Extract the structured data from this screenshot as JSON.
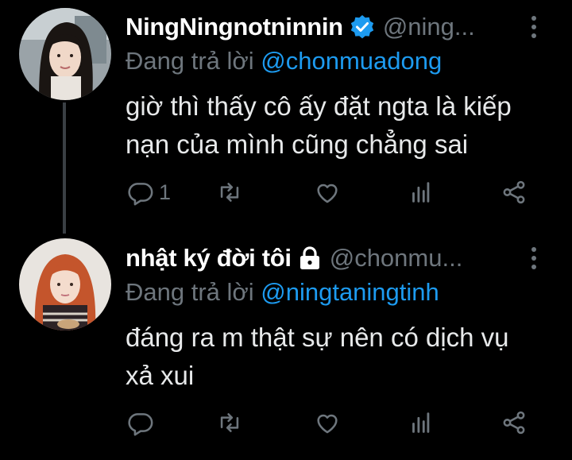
{
  "tweets": [
    {
      "display_name": "NingNingnotninnin",
      "handle": "@ning...",
      "verified": true,
      "replying_prefix": "Đang trả lời",
      "replying_to": "@chonmuadong",
      "text_lines": [
        "giờ thì thấy cô ấy đặt ngta là kiếp",
        "nạn của mình cũng chẳng sai"
      ],
      "reply_count": "1"
    },
    {
      "display_name": "nhật ký đời tôi",
      "handle": "@chonmu...",
      "locked": true,
      "replying_prefix": "Đang trả lời",
      "replying_to": "@ningtaningtinh",
      "text_lines": [
        "đáng ra m thật sự nên có dịch vụ",
        "xả xui"
      ],
      "reply_count": ""
    }
  ],
  "colors": {
    "background": "#000000",
    "text": "#e7e9ea",
    "muted": "#6e767d",
    "accent": "#1d9bf0"
  },
  "icons": [
    "reply-icon",
    "retweet-icon",
    "like-icon",
    "analytics-icon",
    "share-icon",
    "verified-badge-icon",
    "lock-icon",
    "more-icon"
  ]
}
